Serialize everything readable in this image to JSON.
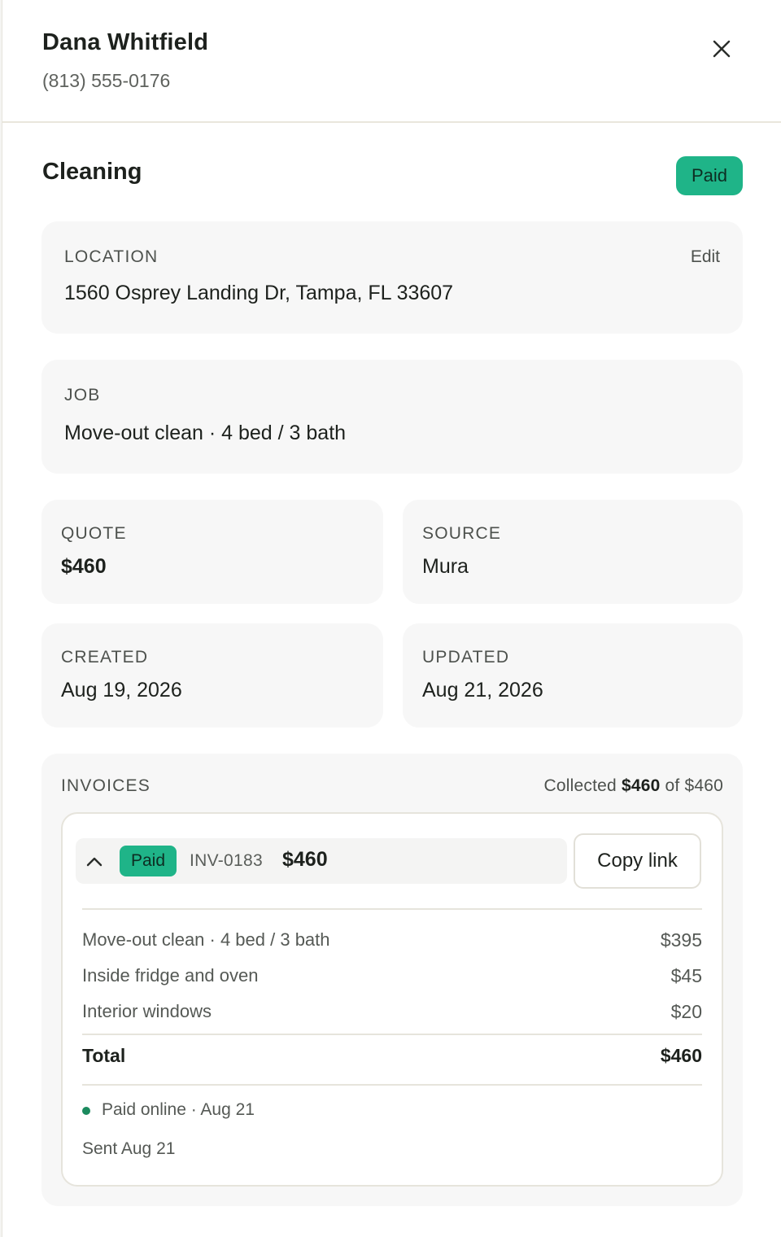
{
  "customer": {
    "name": "Dana Whitfield",
    "phone": "(813) 555-0176"
  },
  "job_title": "Cleaning",
  "status_badge": "Paid",
  "location": {
    "label": "LOCATION",
    "edit_label": "Edit",
    "address": "1560 Osprey Landing Dr, Tampa, FL 33607"
  },
  "job": {
    "label": "JOB",
    "description": "Move-out clean · 4 bed / 3 bath"
  },
  "quote": {
    "label": "QUOTE",
    "value": "$460"
  },
  "source": {
    "label": "SOURCE",
    "value": "Mura"
  },
  "created": {
    "label": "CREATED",
    "value": "Aug 19, 2026"
  },
  "updated": {
    "label": "UPDATED",
    "value": "Aug 21, 2026"
  },
  "invoices": {
    "label": "INVOICES",
    "collected_prefix": "Collected",
    "collected_amount": "$460",
    "collected_of": "of $460",
    "invoice": {
      "status": "Paid",
      "number": "INV-0183",
      "amount": "$460",
      "copy_link_label": "Copy link",
      "line_items": [
        {
          "description": "Move-out clean · 4 bed / 3 bath",
          "amount": "$395"
        },
        {
          "description": "Inside fridge and oven",
          "amount": "$45"
        },
        {
          "description": "Interior windows",
          "amount": "$20"
        }
      ],
      "total_label": "Total",
      "total_amount": "$460",
      "payment_status": "Paid online · Aug 21",
      "sent": "Sent Aug 21"
    }
  },
  "colors": {
    "paid_green": "#1fb488",
    "dot_green": "#1b8a5e",
    "card_bg": "#f7f7f7"
  },
  "icons": [
    "close-icon",
    "chevron-up-icon"
  ]
}
